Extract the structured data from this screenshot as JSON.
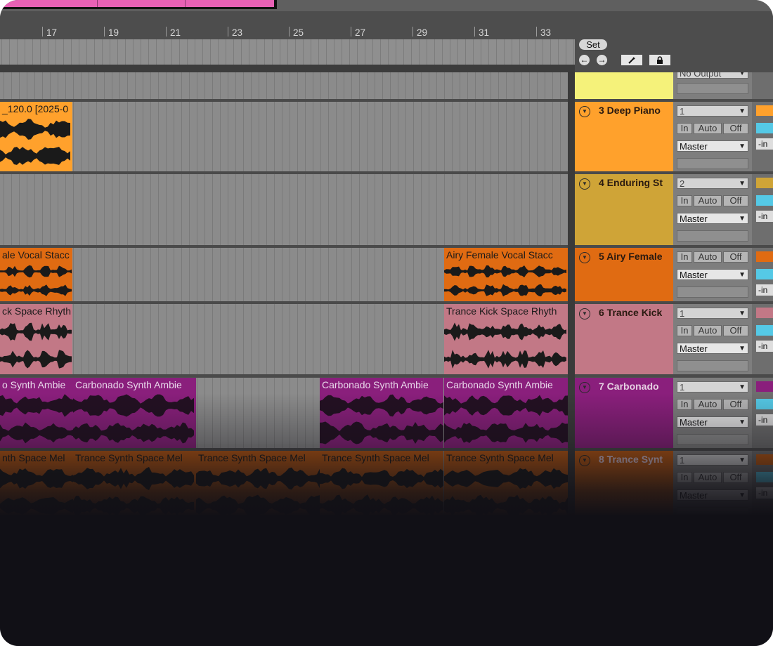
{
  "ruler": {
    "bars": [
      "17",
      "19",
      "21",
      "23",
      "25",
      "27",
      "29",
      "31",
      "33"
    ]
  },
  "controls": {
    "set_label": "Set",
    "prev_icon": "arrow-left-icon",
    "next_icon": "arrow-right-icon",
    "draw_icon": "pencil-icon",
    "lock_icon": "lock-icon"
  },
  "tracks": [
    {
      "name": "",
      "color": "#f5f27a",
      "io": {
        "output": "No Output"
      },
      "clips": []
    },
    {
      "name": "3 Deep Piano",
      "color": "#ffa12c",
      "io": {
        "input_channel": "1",
        "monitor": [
          "In",
          "Auto",
          "Off"
        ],
        "output": "Master",
        "send_value": "-in"
      },
      "clips": [
        {
          "label": "_120.0 [2025-0",
          "color": "#ffa12c"
        }
      ]
    },
    {
      "name": "4 Enduring St",
      "color": "#cfa437",
      "io": {
        "input_channel": "2",
        "monitor": [
          "In",
          "Auto",
          "Off"
        ],
        "output": "Master",
        "send_value": "-in"
      },
      "clips": []
    },
    {
      "name": "5 Airy Female",
      "color": "#e06b12",
      "io": {
        "monitor": [
          "In",
          "Auto",
          "Off"
        ],
        "output": "Master",
        "send_value": "-in"
      },
      "clips": [
        {
          "label": "ale Vocal Stacc",
          "color": "#e06b12"
        },
        {
          "label": "Airy Female Vocal Stacc",
          "color": "#e06b12"
        }
      ]
    },
    {
      "name": "6 Trance Kick",
      "color": "#c27886",
      "io": {
        "input_channel": "1",
        "monitor": [
          "In",
          "Auto",
          "Off"
        ],
        "output": "Master",
        "send_value": "-in"
      },
      "clips": [
        {
          "label": "ck Space Rhyth",
          "color": "#c27886"
        },
        {
          "label": "Trance Kick Space Rhyth",
          "color": "#c27886"
        }
      ]
    },
    {
      "name": "7 Carbonado",
      "color": "#8a1f7c",
      "io": {
        "input_channel": "1",
        "monitor": [
          "In",
          "Auto",
          "Off"
        ],
        "output": "Master",
        "send_value": "-in"
      },
      "clips": [
        {
          "label": "o Synth Ambie",
          "color": "#8a1f7c"
        },
        {
          "label": "Carbonado Synth Ambie",
          "color": "#8a1f7c"
        },
        {
          "label": "Carbonado Synth Ambie",
          "color": "#8a1f7c"
        },
        {
          "label": "Carbonado Synth Ambie",
          "color": "#8a1f7c"
        }
      ]
    },
    {
      "name": "8 Trance Synt",
      "color": "#c25b10",
      "io": {
        "input_channel": "1",
        "monitor": [
          "In",
          "Auto",
          "Off"
        ],
        "output": "Master",
        "send_value": "-in"
      },
      "clips": [
        {
          "label": "nth Space Mel",
          "color": "#c25b10"
        },
        {
          "label": "Trance Synth Space Mel",
          "color": "#c25b10"
        },
        {
          "label": "Trance Synth Space Mel",
          "color": "#c25b10"
        },
        {
          "label": "Trance Synth Space Mel",
          "color": "#c25b10"
        },
        {
          "label": "Trance Synth Space Mel",
          "color": "#c25b10"
        }
      ]
    }
  ]
}
